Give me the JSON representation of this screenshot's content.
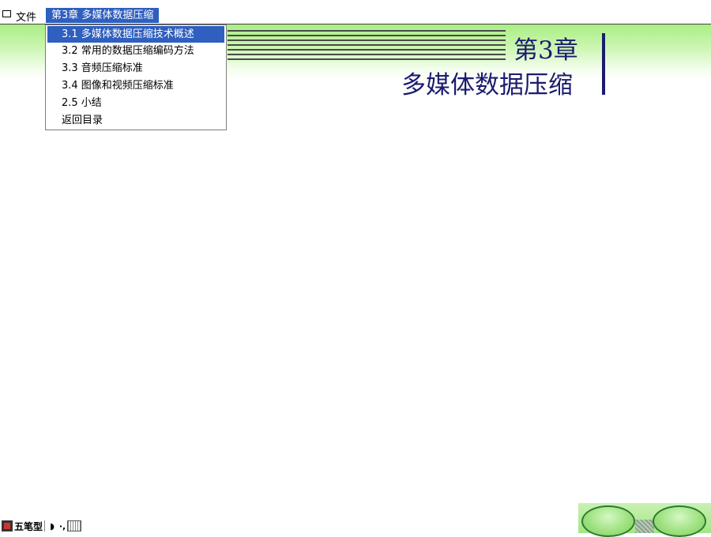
{
  "menubar": {
    "file_label": "文件",
    "chapter_label": "第3章 多媒体数据压缩"
  },
  "dropdown": {
    "items": [
      {
        "label": "3.1 多媒体数据压缩技术概述",
        "selected": true
      },
      {
        "label": "3.2 常用的数据压缩编码方法",
        "selected": false
      },
      {
        "label": "3.3 音频压缩标准",
        "selected": false
      },
      {
        "label": "3.4 图像和视频压缩标准",
        "selected": false
      },
      {
        "label": "2.5 小结",
        "selected": false
      },
      {
        "label": "返回目录",
        "selected": false
      }
    ]
  },
  "heading": {
    "chapter": "第3章",
    "title": "多媒体数据压缩"
  },
  "ime": {
    "label": "五笔型"
  },
  "colors": {
    "accent": "#2f5fbf",
    "heading": "#1b1b6e",
    "band": "#a8ee82",
    "nav_button": "#9be07c"
  }
}
